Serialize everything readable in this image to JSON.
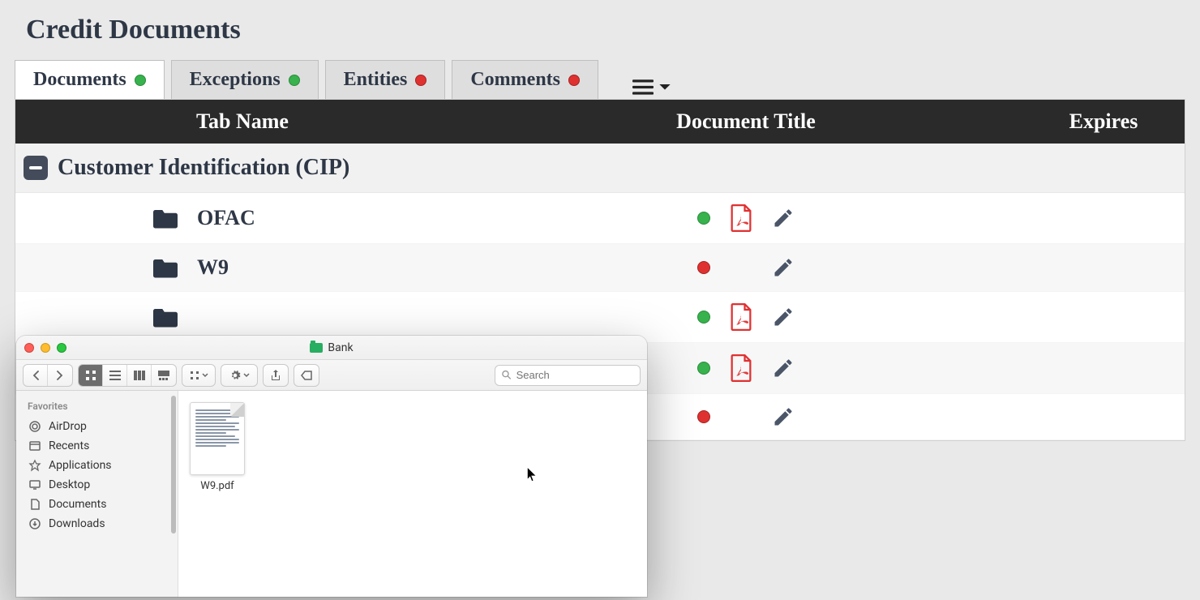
{
  "page": {
    "title": "Credit Documents"
  },
  "tabs": [
    {
      "label": "Documents",
      "status": "green",
      "active": true
    },
    {
      "label": "Exceptions",
      "status": "green",
      "active": false
    },
    {
      "label": "Entities",
      "status": "red",
      "active": false
    },
    {
      "label": "Comments",
      "status": "red",
      "active": false
    }
  ],
  "columns": {
    "tab": "Tab Name",
    "doc": "Document Title",
    "exp": "Expires"
  },
  "group": {
    "title": "Customer Identification (CIP)"
  },
  "rows": [
    {
      "name": "OFAC",
      "status": "green",
      "has_pdf": true
    },
    {
      "name": "W9",
      "status": "red",
      "has_pdf": false
    },
    {
      "name": "",
      "status": "green",
      "has_pdf": true
    },
    {
      "name": "",
      "status": "green",
      "has_pdf": true
    },
    {
      "name": "",
      "status": "red",
      "has_pdf": false
    }
  ],
  "finder": {
    "title": "Bank",
    "search_placeholder": "Search",
    "sidebar_header": "Favorites",
    "sidebar": [
      {
        "label": "AirDrop",
        "icon": "airdrop"
      },
      {
        "label": "Recents",
        "icon": "recents"
      },
      {
        "label": "Applications",
        "icon": "apps"
      },
      {
        "label": "Desktop",
        "icon": "desktop"
      },
      {
        "label": "Documents",
        "icon": "documents"
      },
      {
        "label": "Downloads",
        "icon": "downloads"
      }
    ],
    "file": {
      "name": "W9.pdf"
    }
  }
}
